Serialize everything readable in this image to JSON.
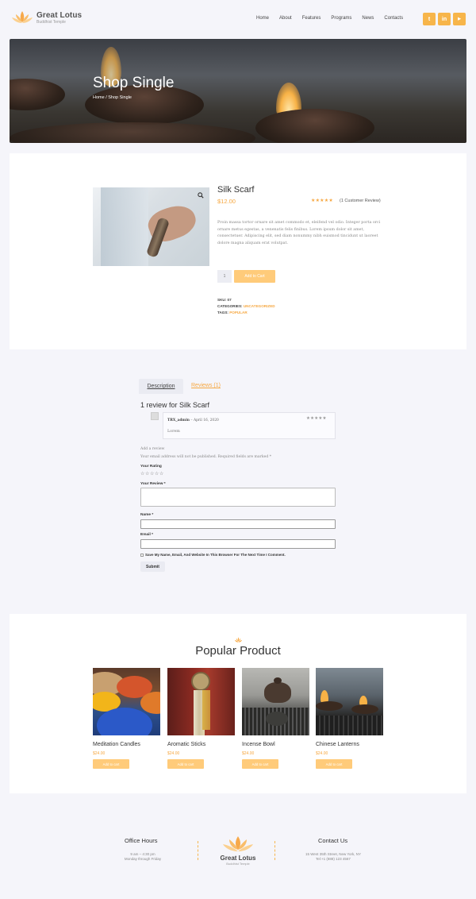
{
  "brand": {
    "name": "Great Lotus",
    "tagline": "Buddhist Temple"
  },
  "nav": [
    "Home",
    "About",
    "Features",
    "Programs",
    "News",
    "Contacts"
  ],
  "social": [
    {
      "icon": "twitter-icon",
      "glyph": "t"
    },
    {
      "icon": "linkedin-icon",
      "glyph": "in"
    },
    {
      "icon": "youtube-icon",
      "glyph": "▶"
    }
  ],
  "hero": {
    "title": "Shop Single",
    "breadcrumb_home": "Home",
    "breadcrumb_sep": " / ",
    "breadcrumb_current": "Shop Single"
  },
  "product": {
    "title": "Silk Scarf",
    "price": "$12.00",
    "stars": "★★★★★",
    "rating": 5,
    "review_count": "(1 Customer Review)",
    "description": "Proin massa tortor ornare sit amet commodo et, eleifend vel odio. Integer porta orci ornare metus egestas, a venenatis felis finibus. Lorem ipsum dolor sit amet, consectetuer. Adipiscing elit, sed diam nonummy nibh euismod tincidunt ut laoreet dolore magna aliquam erat volutpat.",
    "quantity": "1",
    "add_to_cart": "Add to Cart",
    "sku_label": "SKU:",
    "sku": "07",
    "categories_label": "CATEGORIES:",
    "categories": "UNCATEGORIZED",
    "tags_label": "TAGS:",
    "tags": "POPULAR"
  },
  "tabs": {
    "description": "Description",
    "reviews": "Reviews (1)"
  },
  "reviews": {
    "heading": "1 review for Silk Scarf",
    "items": [
      {
        "author": "TRX_admin",
        "date": "– April 16, 2020",
        "stars": "★★★★★",
        "text": "Lorem"
      }
    ]
  },
  "review_form": {
    "add_review": "Add a review",
    "notice": "Your email address will not be published. Required fields are marked *",
    "rating_label": "Your Rating",
    "rating_stars": "☆☆☆☆☆",
    "review_label": "Your Review *",
    "name_label": "Name *",
    "email_label": "Email *",
    "save_label": "Save My Name, Email, And Website In This Browser For The Next Time I Comment.",
    "submit": "Submit"
  },
  "popular": {
    "title": "Popular Product",
    "products": [
      {
        "name": "Meditation Candles",
        "price": "$24.00",
        "button": "Add to cart"
      },
      {
        "name": "Aromatic Sticks",
        "price": "$24.00",
        "button": "Add to cart"
      },
      {
        "name": "Incense Bowl",
        "price": "$24.00",
        "button": "Add to cart"
      },
      {
        "name": "Chinese Lanterns",
        "price": "$24.00",
        "button": "Add to cart"
      }
    ]
  },
  "footer": {
    "office_title": "Office Hours",
    "office_line1": "9 am – 4:30 pm",
    "office_line2": "Monday through Friday",
    "brand": "Great Lotus",
    "tagline": "Buddhist Temple",
    "contact_title": "Contact Us",
    "contact_line1": "15 West 35th Street, New York, NY",
    "contact_line2": "Tel:+1 (888) 123 4567"
  },
  "colors": {
    "accent": "#f6a740",
    "button": "#ffcb7a",
    "background": "#f5f5fa"
  }
}
